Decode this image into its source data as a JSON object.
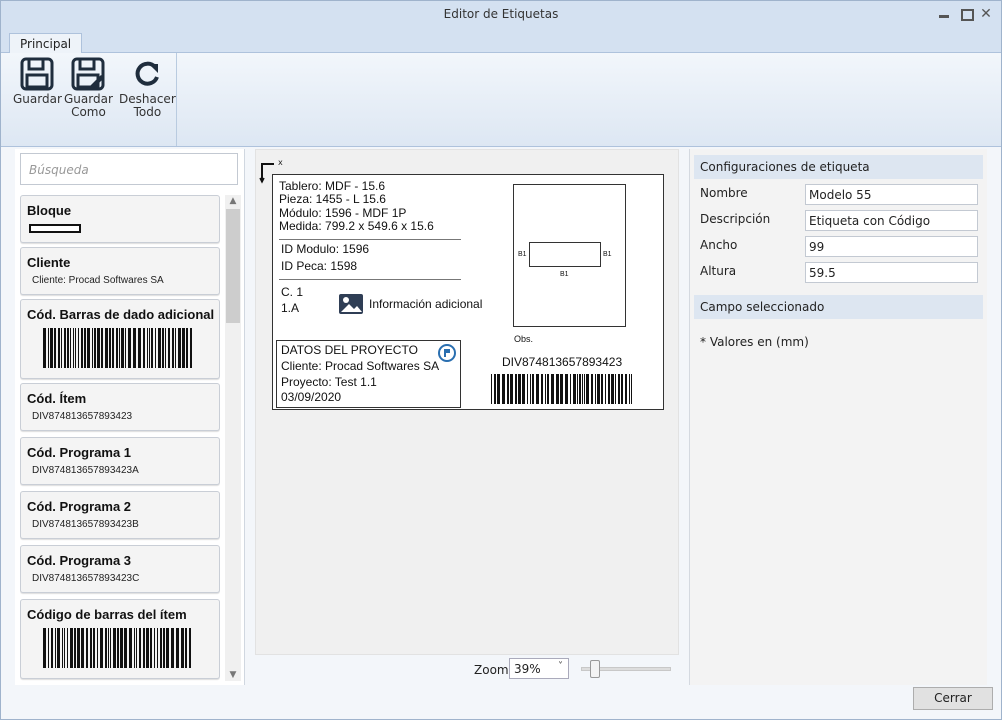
{
  "window": {
    "title": "Editor de Etiquetas"
  },
  "ribbon": {
    "tab": "Principal",
    "buttons": {
      "save": "Guardar",
      "save_as_1": "Guardar",
      "save_as_2": "Como",
      "undo_1": "Deshacer",
      "undo_2": "Todo"
    }
  },
  "search": {
    "placeholder": "Búsqueda"
  },
  "fields": {
    "bloque": "Bloque",
    "cliente": "Cliente",
    "cliente_sub": "Cliente: Procad Softwares SA",
    "cod_barras_adicional": "Cód. Barras de dado adicional",
    "cod_item": "Cód. Ítem",
    "cod_item_sub": "DIV874813657893423",
    "cod_prog1": "Cód. Programa 1",
    "cod_prog1_sub": "DIV874813657893423A",
    "cod_prog2": "Cód. Programa 2",
    "cod_prog2_sub": "DIV874813657893423B",
    "cod_prog3": "Cód. Programa 3",
    "cod_prog3_sub": "DIV874813657893423C",
    "cod_barras_item": "Código de barras del ítem"
  },
  "canvas": {
    "axis_label": "x",
    "label": {
      "tablero": "Tablero: MDF - 15.6",
      "pieza": "Pieza: 1455 - L 15.6",
      "modulo": "Módulo: 1596 - MDF 1P",
      "medida": "Medida: 799.2 x 549.6 x 15.6",
      "id_modulo": "ID Modulo: 1596",
      "id_peca": "ID Peca: 1598",
      "c1": "C. 1",
      "c1a": "1.A",
      "info_adicional": "Información adicional",
      "drawing_b1": "B1",
      "obs": "Obs.",
      "project_title": "DATOS DEL PROYECTO",
      "project_client": "Cliente: Procad Softwares SA",
      "project_name": "Proyecto: Test 1.1",
      "project_date": "03/09/2020",
      "barcode_text": "DIV874813657893423"
    }
  },
  "zoom": {
    "label": "Zoom",
    "value": "39%",
    "slider_fraction": 0.1
  },
  "properties": {
    "config_header": "Configuraciones de etiqueta",
    "nombre_label": "Nombre",
    "nombre_value": "Modelo 55",
    "descripcion_label": "Descripción",
    "descripcion_value": "Etiqueta con Código",
    "ancho_label": "Ancho",
    "ancho_value": "99",
    "altura_label": "Altura",
    "altura_value": "59.5",
    "selected_header": "Campo seleccionado",
    "note": "* Valores en (mm)"
  },
  "footer": {
    "close": "Cerrar"
  }
}
